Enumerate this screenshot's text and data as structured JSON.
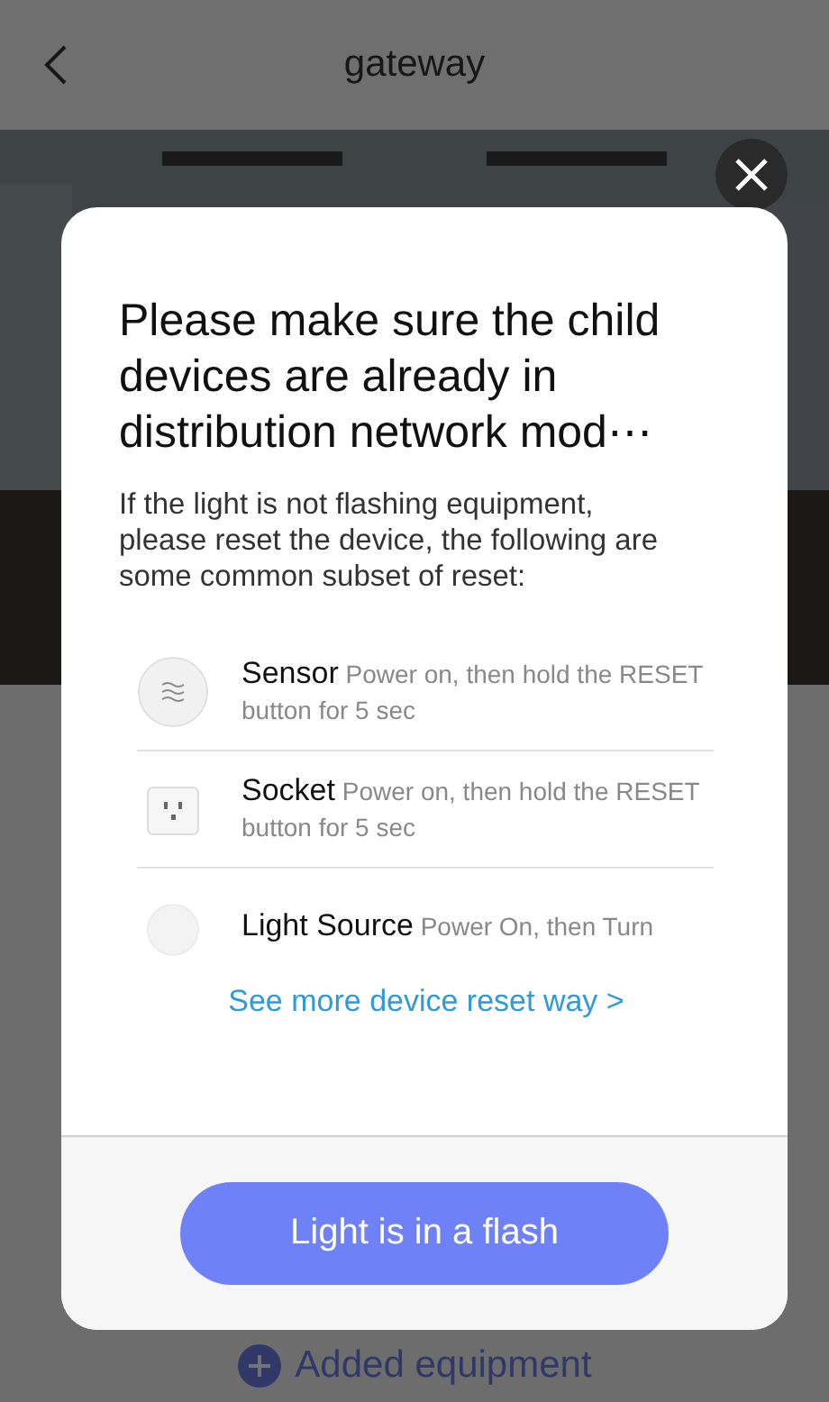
{
  "header": {
    "title": "gateway"
  },
  "background": {
    "add_label": "Added equipment"
  },
  "dialog": {
    "title": "Please make sure the child devices are already in distribution network mod⋯",
    "message": "If the light is not flashing equipment, please reset the device, the following are some common subset of reset:",
    "devices": [
      {
        "kind": "sensor",
        "name": "Sensor",
        "instruction": "Power on, then hold the RESET button for 5 sec"
      },
      {
        "kind": "socket",
        "name": "Socket",
        "instruction": "Power on, then hold the RESET button for 5 sec"
      },
      {
        "kind": "bulb",
        "name": "Light Source",
        "instruction": "Power On, then Turn"
      }
    ],
    "link": "See more device reset way >",
    "button": "Light is in a flash"
  }
}
